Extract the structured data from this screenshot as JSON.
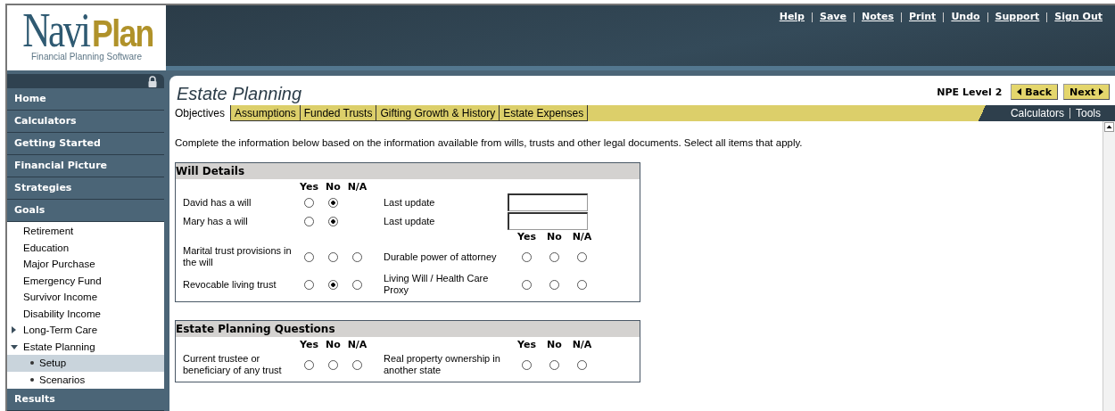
{
  "logo": {
    "parts": [
      "Navi",
      "Plan"
    ],
    "tagline": "Financial Planning Software"
  },
  "top_links": [
    "Help",
    "Save",
    "Notes",
    "Print",
    "Undo",
    "Support",
    "Sign Out"
  ],
  "nav": [
    {
      "label": "Home",
      "selected": false
    },
    {
      "label": "Calculators",
      "selected": false
    },
    {
      "label": "Getting Started",
      "selected": false
    },
    {
      "label": "Financial Picture",
      "selected": false
    },
    {
      "label": "Strategies",
      "selected": false
    },
    {
      "label": "Goals",
      "selected": false,
      "expanded": true,
      "children": [
        {
          "label": "Retirement",
          "selected": false
        },
        {
          "label": "Education",
          "selected": false
        },
        {
          "label": "Major Purchase",
          "selected": false
        },
        {
          "label": "Emergency Fund",
          "selected": false
        },
        {
          "label": "Survivor Income",
          "selected": false
        },
        {
          "label": "Disability Income",
          "selected": false
        },
        {
          "label": "Long-Term Care",
          "selected": false,
          "expanded": false
        },
        {
          "label": "Estate Planning",
          "selected": false,
          "expanded": true,
          "children": [
            {
              "label": "Setup",
              "selected": true
            },
            {
              "label": "Scenarios",
              "selected": false
            }
          ]
        }
      ]
    },
    {
      "label": "Results",
      "selected": false
    }
  ],
  "page": {
    "title": "Estate Planning",
    "level": "NPE Level 2",
    "back": "Back",
    "next": "Next"
  },
  "tabs": [
    {
      "label": "Objectives",
      "selected": true
    },
    {
      "label": "Assumptions",
      "selected": false
    },
    {
      "label": "Funded Trusts",
      "selected": false
    },
    {
      "label": "Gifting Growth & History",
      "selected": false
    },
    {
      "label": "Estate Expenses",
      "selected": false
    }
  ],
  "side_links": [
    "Calculators",
    "Tools"
  ],
  "intro": "Complete the information below based on the information available from wills, trusts and other legal documents. Select all items that apply.",
  "sections": [
    {
      "title": "Will Details",
      "rows": [
        {
          "left": {
            "kind": "heads",
            "labels": [
              "Yes",
              "No",
              "N/A"
            ]
          }
        },
        {
          "left": {
            "kind": "radios",
            "label": "David has a will",
            "options": [
              {
                "selected": false
              },
              {
                "selected": true
              }
            ]
          },
          "right": {
            "kind": "date",
            "label": "Last update"
          }
        },
        {
          "left": {
            "kind": "radios",
            "label": "Mary has a will",
            "options": [
              {
                "selected": false
              },
              {
                "selected": true
              }
            ]
          },
          "right": {
            "kind": "date",
            "label": "Last update"
          }
        },
        {
          "right": {
            "kind": "heads",
            "labels": [
              "Yes",
              "No",
              "N/A"
            ]
          }
        },
        {
          "left": {
            "kind": "radios",
            "label": "Marital trust provisions in the will",
            "options": [
              {
                "selected": false
              },
              {
                "selected": false
              },
              {
                "selected": false
              }
            ]
          },
          "right": {
            "kind": "radios",
            "label": "Durable power of attorney",
            "options": [
              {
                "selected": false
              },
              {
                "selected": false
              },
              {
                "selected": false
              }
            ]
          }
        },
        {
          "left": {
            "kind": "radios",
            "label": "Revocable living trust",
            "options": [
              {
                "selected": false
              },
              {
                "selected": true
              },
              {
                "selected": false
              }
            ]
          },
          "right": {
            "kind": "radios",
            "label": "Living Will / Health Care Proxy",
            "options": [
              {
                "selected": false
              },
              {
                "selected": false
              },
              {
                "selected": false
              }
            ]
          }
        }
      ]
    },
    {
      "title": "Estate Planning Questions",
      "rows": [
        {
          "left": {
            "kind": "heads",
            "labels": [
              "Yes",
              "No",
              "N/A"
            ]
          },
          "right": {
            "kind": "heads",
            "labels": [
              "Yes",
              "No",
              "N/A"
            ]
          }
        },
        {
          "left": {
            "kind": "radios",
            "label": "Current trustee or beneficiary of any trust",
            "options": [
              {
                "selected": false
              },
              {
                "selected": false
              },
              {
                "selected": false
              }
            ]
          },
          "right": {
            "kind": "radios",
            "label": "Real property ownership in another state",
            "options": [
              {
                "selected": false
              },
              {
                "selected": false
              },
              {
                "selected": false
              }
            ]
          }
        }
      ]
    }
  ]
}
